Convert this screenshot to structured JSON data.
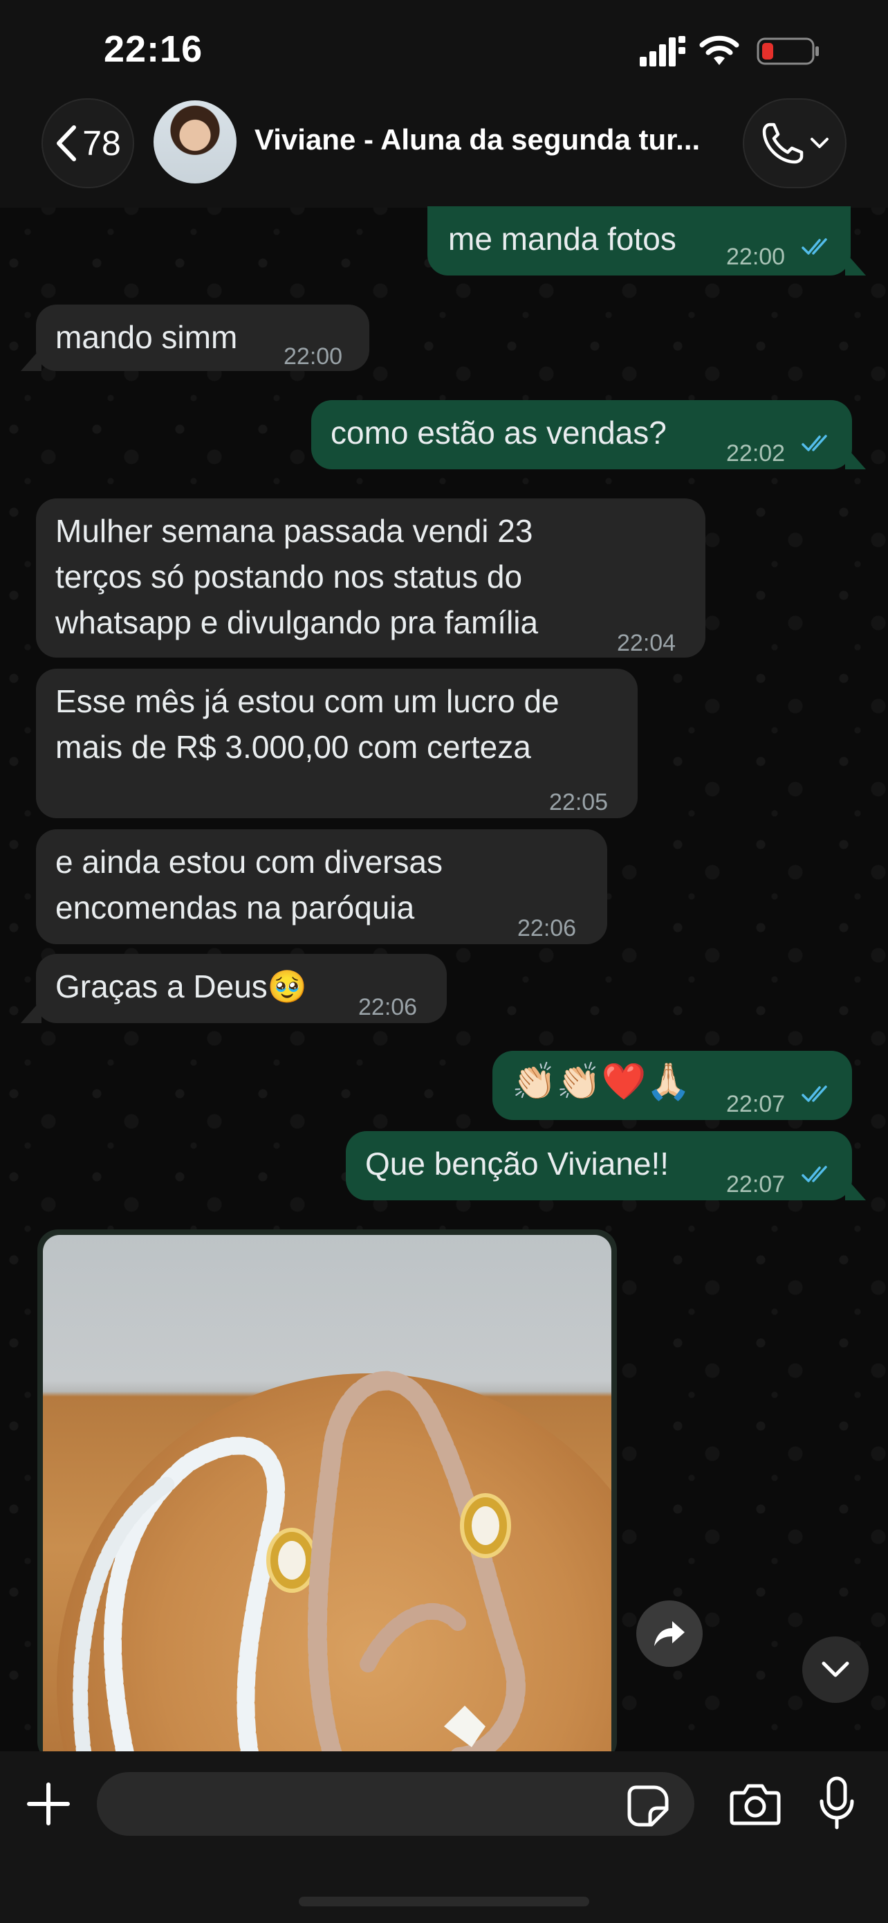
{
  "status_bar": {
    "time": "22:16"
  },
  "header": {
    "back_count": "78",
    "contact_name": "Viviane - Aluna da segunda tur..."
  },
  "messages": [
    {
      "direction": "out",
      "text": "me manda fotos",
      "time": "22:00",
      "read": true
    },
    {
      "direction": "in",
      "text": "mando simm",
      "time": "22:00"
    },
    {
      "direction": "out",
      "text": "como estão as vendas?",
      "time": "22:02",
      "read": true
    },
    {
      "direction": "in",
      "text": "Mulher semana passada vendi 23\nterços só postando nos status do\nwhatsapp e divulgando pra família",
      "time": "22:04"
    },
    {
      "direction": "in",
      "text": "Esse mês já estou com um lucro de\nmais de R$ 3.000,00 com certeza",
      "time": "22:05"
    },
    {
      "direction": "in",
      "text": "e ainda estou com diversas\nencomendas na paróquia",
      "time": "22:06"
    },
    {
      "direction": "in",
      "text": "Graças a Deus🥹",
      "time": "22:06"
    },
    {
      "direction": "out",
      "text": "👏🏻👏🏻❤️🙏🏻",
      "time": "22:07",
      "read": true
    },
    {
      "direction": "out",
      "text": "Que benção Viviane!!",
      "time": "22:07",
      "read": true
    }
  ],
  "image_message": {
    "direction": "in"
  },
  "input": {
    "placeholder": ""
  },
  "colors": {
    "outgoing_bubble": "#144d37",
    "incoming_bubble": "#262626",
    "read_tick": "#53bdeb",
    "battery_low": "#e5302b"
  }
}
